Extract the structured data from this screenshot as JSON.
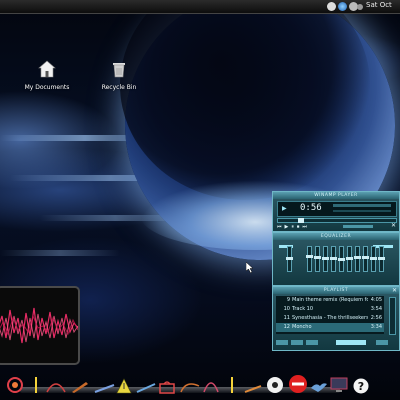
{
  "top_panel": {
    "clock": "Sat Oct",
    "tray_icons": [
      "network-icon",
      "browser-icon",
      "volume-icon",
      "user-icon"
    ]
  },
  "desktop_icons": [
    {
      "label": "My Documents",
      "icon": "home-icon"
    },
    {
      "label": "Recycle Bin",
      "icon": "trash-icon"
    }
  ],
  "winamp": {
    "title": "WINAMP PLAYER",
    "time": "0:56",
    "equalizer_title": "EQUALIZER",
    "playlist_title": "PLAYLIST",
    "playlist": [
      {
        "num": "9",
        "title": "Main theme remix (Requiem for ...",
        "duration": "4:05",
        "selected": false
      },
      {
        "num": "10",
        "title": "Track 10",
        "duration": "3:54",
        "selected": false
      },
      {
        "num": "11",
        "title": "Synesthasia - The thrillseekers",
        "duration": "2:56",
        "selected": false
      },
      {
        "num": "12",
        "title": "Moncho",
        "duration": "3:34",
        "selected": true
      }
    ],
    "colors": {
      "accent": "#6fb7c7",
      "panel": "#2d5a66"
    }
  },
  "dock": {
    "items": [
      "app-swirl-icon",
      "pen-icon",
      "bow-icon",
      "brush-icon",
      "triangle-icon",
      "pencil-icon",
      "bag-icon",
      "palette-icon",
      "curve-icon",
      "line-icon",
      "flame-icon",
      "disc-icon",
      "red-button-icon",
      "bird-icon",
      "screen-icon",
      "help-icon"
    ]
  }
}
